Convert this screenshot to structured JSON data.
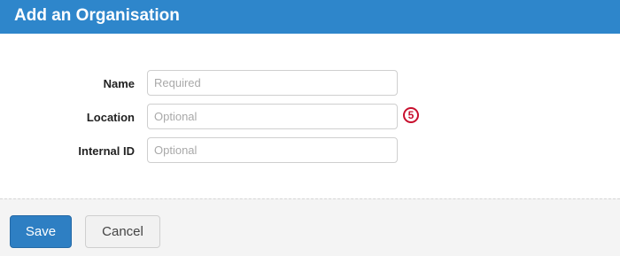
{
  "dialog": {
    "title": "Add an Organisation"
  },
  "form": {
    "fields": [
      {
        "label": "Name",
        "placeholder": "Required",
        "value": ""
      },
      {
        "label": "Location",
        "placeholder": "Optional",
        "value": ""
      },
      {
        "label": "Internal ID",
        "placeholder": "Optional",
        "value": ""
      }
    ],
    "callout_number": "5"
  },
  "footer": {
    "save_label": "Save",
    "cancel_label": "Cancel"
  },
  "colors": {
    "header": "#2e86cb",
    "save_button": "#2e7fc3",
    "callout": "#c8102e"
  }
}
